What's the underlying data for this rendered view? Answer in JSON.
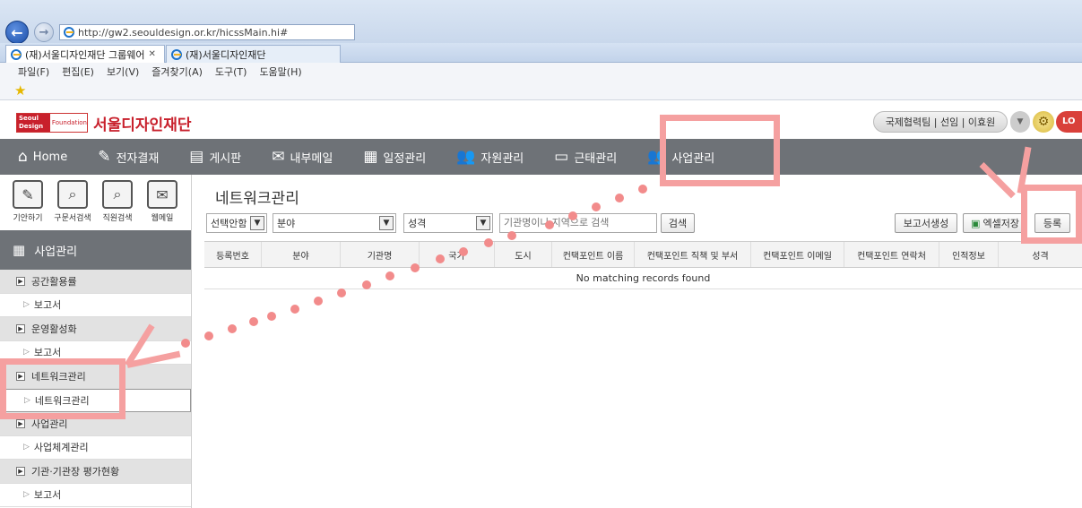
{
  "browser": {
    "url": "http://gw2.seouldesign.or.kr/hicssMain.hi#",
    "tabs": [
      {
        "label": "(재)서울디자인재단 그룹웨어",
        "active": true
      },
      {
        "label": "(재)서울디자인재단",
        "active": false
      }
    ],
    "menu": [
      "파일(F)",
      "편집(E)",
      "보기(V)",
      "즐겨찾기(A)",
      "도구(T)",
      "도움말(H)"
    ]
  },
  "header": {
    "logo_top": "Seoul Design",
    "logo_bottom": "Foundation",
    "org_name": "서울디자인재단",
    "user": "국제협력팀 | 선임 | 이효원",
    "logout": "LO"
  },
  "topnav": [
    {
      "label": "Home",
      "icon": "home-icon"
    },
    {
      "label": "전자결재",
      "icon": "pen-icon"
    },
    {
      "label": "게시판",
      "icon": "board-icon"
    },
    {
      "label": "내부메일",
      "icon": "mail-icon"
    },
    {
      "label": "일정관리",
      "icon": "calendar-icon"
    },
    {
      "label": "자원관리",
      "icon": "people-icon"
    },
    {
      "label": "근태관리",
      "icon": "id-card-icon"
    },
    {
      "label": "사업관리",
      "icon": "people-icon"
    }
  ],
  "quick": [
    "기안하기",
    "구문서검색",
    "직원검색",
    "웹메일"
  ],
  "sidebar": {
    "title": "사업관리",
    "rows": [
      {
        "label": "공간활용률",
        "type": "group"
      },
      {
        "label": "보고서",
        "type": "sub"
      },
      {
        "label": "운영활성화",
        "type": "group"
      },
      {
        "label": "보고서",
        "type": "sub"
      },
      {
        "label": "네트워크관리",
        "type": "group"
      },
      {
        "label": "네트워크관리",
        "type": "sub",
        "selected": true
      },
      {
        "label": "사업관리",
        "type": "group"
      },
      {
        "label": "사업체계관리",
        "type": "sub"
      },
      {
        "label": "기관·기관장 평가현황",
        "type": "group"
      },
      {
        "label": "보고서",
        "type": "sub"
      }
    ]
  },
  "main": {
    "title": "네트워크관리",
    "filters": {
      "select_all": "선택안함",
      "field": "분야",
      "type": "성격",
      "search_placeholder": "기관명이나 지역으로 검색",
      "search_btn": "검색"
    },
    "actions": {
      "report": "보고서생성",
      "excel": "엑셀저장",
      "register": "등록"
    },
    "columns": [
      "등록번호",
      "분야",
      "기관명",
      "국가",
      "도시",
      "컨택포인트 이름",
      "컨택포인트 직책 및 부서",
      "컨택포인트 이메일",
      "컨택포인트 연락처",
      "인적정보",
      "성격"
    ],
    "empty_message": "No matching records found"
  },
  "colors": {
    "nav_bg": "#6e7277",
    "highlight": "#f5a0a0",
    "brand": "#c8202c"
  }
}
